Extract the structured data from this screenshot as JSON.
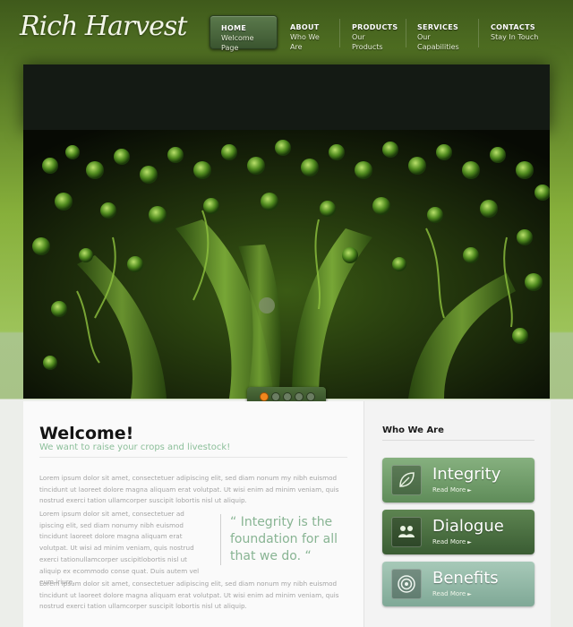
{
  "brand": {
    "logo_text": "Rich Harvest"
  },
  "nav": {
    "items": [
      {
        "title": "HOME",
        "subtitle": "Welcome Page"
      },
      {
        "title": "ABOUT",
        "subtitle": "Who We Are"
      },
      {
        "title": "PRODUCTS",
        "subtitle": "Our Products"
      },
      {
        "title": "SERVICES",
        "subtitle": "Our Capabilities"
      },
      {
        "title": "CONTACTS",
        "subtitle": "Stay In Touch"
      }
    ],
    "active_index": 0
  },
  "slider": {
    "slide_count": 5,
    "active_slide": 1
  },
  "welcome": {
    "title": "Welcome!",
    "subtitle": "We want to raise your crops and livestock!",
    "para1": "Lorem ipsum dolor sit amet, consectetuer adipiscing elit, sed diam nonum my nibh euismod tincidunt ut laoreet dolore magna aliquam erat volutpat. Ut wisi enim ad minim veniam, quis nostrud exerci tation ullamcorper suscipit lobortis nisl ut aliquip.",
    "para2": "Lorem ipsum dolor sit amet, consectetuer ad ipiscing elit, sed diam nonumy nibh euismod tincidunt laoreet dolore magna aliquam erat volutpat. Ut wisi ad minim veniam, quis nostrud exerci tationullamcorper uscipitlobortis nisl ut aliquip ex ecommodo conse quat. Duis autem vel eum iriure.",
    "para3": "Lorem ipsum dolor sit amet, consectetuer adipiscing elit, sed diam nonum my nibh euismod tincidunt ut laoreet dolore magna aliquam erat volutpat. Ut wisi enim ad minim veniam, quis nostrud exerci tation ullamcorper suscipit lobortis nisl ut aliquip.",
    "quote": "“ Integrity is the foundation for all that we do. “"
  },
  "sidebar": {
    "title": "Who We Are",
    "cards": [
      {
        "title": "Integrity",
        "more": "Read More",
        "icon": "leaf-icon",
        "color_top": "#86b07f",
        "color_bottom": "#5f8c59"
      },
      {
        "title": "Dialogue",
        "more": "Read More",
        "icon": "people-icon",
        "color_top": "#5d8451",
        "color_bottom": "#3a5c33"
      },
      {
        "title": "Benefits",
        "more": "Read More",
        "icon": "target-icon",
        "color_top": "#a7c9b8",
        "color_bottom": "#7fa896"
      }
    ]
  },
  "colors": {
    "accent_green": "#8cbf9a",
    "active_dot": "#f0871d"
  }
}
